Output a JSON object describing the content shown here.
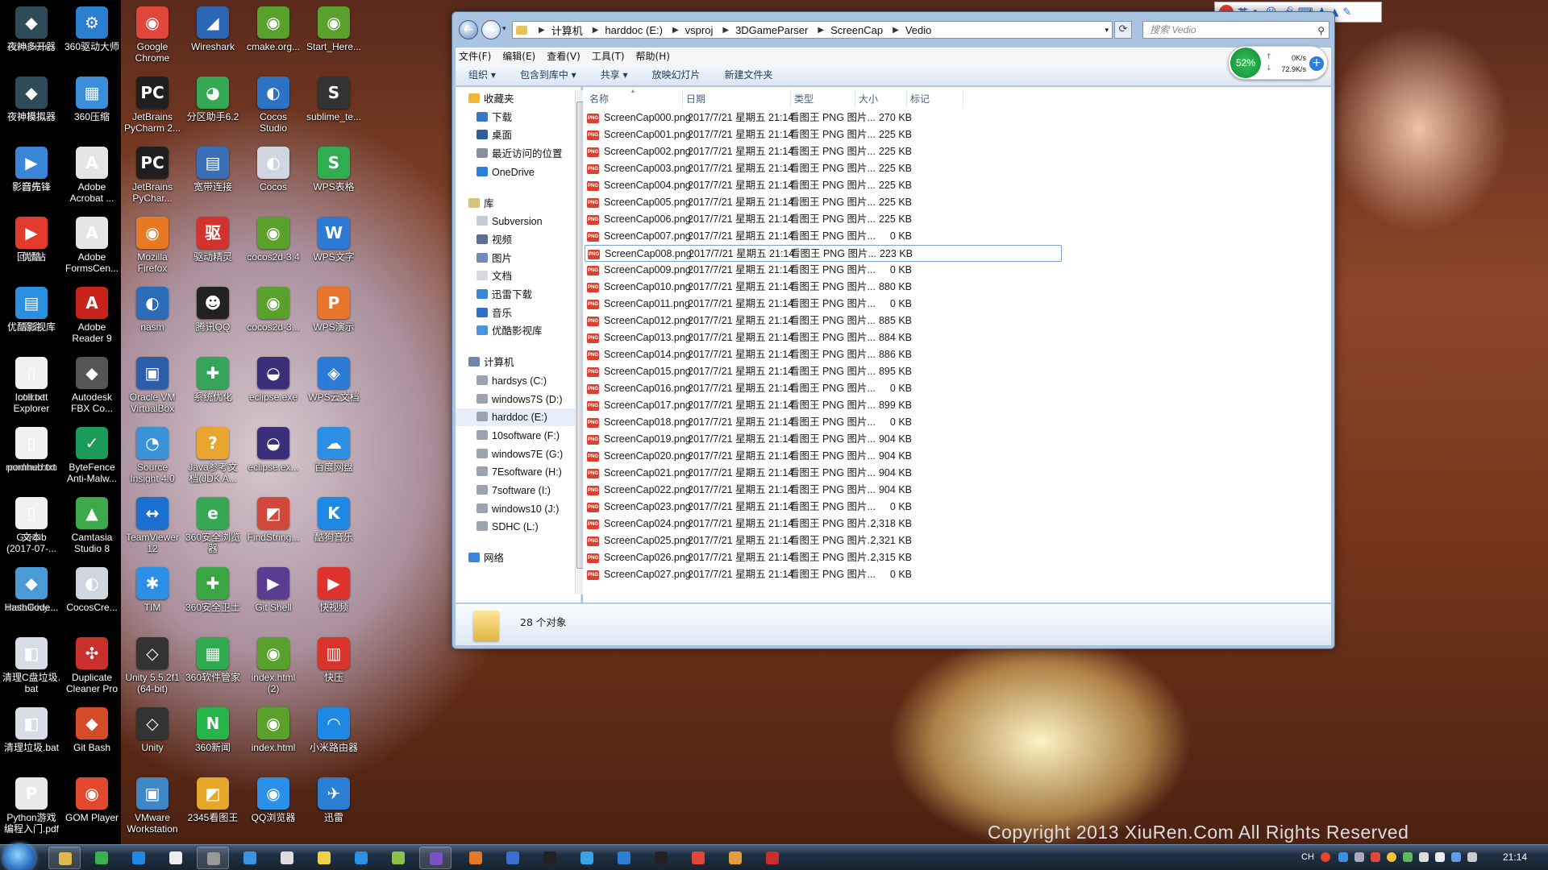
{
  "desktop": {
    "watermark": "Copyright 2013 XiuRen.Com  All Rights Reserved",
    "icons": [
      {
        "label": "Administr...",
        "glyph": "▮",
        "color": "#e0b74a"
      },
      {
        "label": "计算机",
        "glyph": "▭",
        "color": "#3a7bd5"
      },
      {
        "label": "网络",
        "glyph": "◍",
        "color": "#2a8ad4"
      },
      {
        "label": "回收站",
        "glyph": "♻",
        "color": "#9aa6b2"
      },
      {
        "label": "璐璐",
        "glyph": "▮",
        "color": "#e0b74a"
      },
      {
        "label": "Internet\nExplorer",
        "glyph": "e",
        "color": "#1e7bd6"
      },
      {
        "label": "readme.htm",
        "glyph": "◉",
        "color": "#5aa02c"
      },
      {
        "label": "GitHub",
        "glyph": "●",
        "color": "#6a4fb5"
      },
      {
        "label": "installkivy...",
        "glyph": "◧",
        "color": "#d8dde6"
      },
      {
        "label": "清理C盘垃圾.\nbat",
        "glyph": "◧",
        "color": "#d8dde6"
      },
      {
        "label": "清理垃圾.bat",
        "glyph": "◧",
        "color": "#d8dde6"
      },
      {
        "label": "Python游戏\n编程入门.pdf",
        "glyph": "P",
        "color": "#e9e9e9"
      },
      {
        "label": "360驱动大师",
        "glyph": "⚙",
        "color": "#2b7fd0"
      },
      {
        "label": "360压缩",
        "glyph": "▦",
        "color": "#3b8fd9"
      },
      {
        "label": "Adobe\nAcrobat ...",
        "glyph": "A",
        "color": "#e5e5e5"
      },
      {
        "label": "Adobe\nFormsCen...",
        "glyph": "A",
        "color": "#e5e5e5"
      },
      {
        "label": "Adobe\nReader 9",
        "glyph": "A",
        "color": "#c9241b"
      },
      {
        "label": "Autodesk\nFBX Co...",
        "glyph": "◆",
        "color": "#555"
      },
      {
        "label": "ByteFence\nAnti-Malw...",
        "glyph": "✓",
        "color": "#1b9b5a"
      },
      {
        "label": "Camtasia\nStudio 8",
        "glyph": "▲",
        "color": "#3da94b"
      },
      {
        "label": "CocosCre...",
        "glyph": "◐",
        "color": "#cfd6e0"
      },
      {
        "label": "Duplicate\nCleaner Pro",
        "glyph": "✣",
        "color": "#c9302c"
      },
      {
        "label": "Git Bash",
        "glyph": "◆",
        "color": "#d54b2a"
      },
      {
        "label": "GOM Player",
        "glyph": "◉",
        "color": "#e14a2e"
      },
      {
        "label": "Google\nChrome",
        "glyph": "◉",
        "color": "#e0463a"
      },
      {
        "label": "JetBrains\nPyCharm 2...",
        "glyph": "PC",
        "color": "#1f1f1f"
      },
      {
        "label": "JetBrains\nPyChar...",
        "glyph": "PC",
        "color": "#1f1f1f"
      },
      {
        "label": "Mozilla\nFirefox",
        "glyph": "◉",
        "color": "#e77824"
      },
      {
        "label": "nasm",
        "glyph": "◐",
        "color": "#2c6bb8"
      },
      {
        "label": "Oracle VM\nVirtualBox",
        "glyph": "▣",
        "color": "#2c5da8"
      },
      {
        "label": "Source\nInsight 4.0",
        "glyph": "◔",
        "color": "#3a93d8"
      },
      {
        "label": "TeamViewer\n12",
        "glyph": "↔",
        "color": "#1b6fd0"
      },
      {
        "label": "TIM",
        "glyph": "✱",
        "color": "#2a8fe6"
      },
      {
        "label": "Unity 5.5.2f1\n(64-bit)",
        "glyph": "◇",
        "color": "#333"
      },
      {
        "label": "Unity",
        "glyph": "◇",
        "color": "#333"
      },
      {
        "label": "VMware\nWorkstation",
        "glyph": "▣",
        "color": "#3f86c7"
      },
      {
        "label": "Wireshark",
        "glyph": "◢",
        "color": "#2b67b5"
      },
      {
        "label": "分区助手6.2",
        "glyph": "◕",
        "color": "#34a853"
      },
      {
        "label": "宽带连接",
        "glyph": "▤",
        "color": "#3a6fb8"
      },
      {
        "label": "驱动精灵",
        "glyph": "驱",
        "color": "#d4322c"
      },
      {
        "label": "腾讯QQ",
        "glyph": "☻",
        "color": "#222"
      },
      {
        "label": "系统优化",
        "glyph": "✚",
        "color": "#37a45b"
      },
      {
        "label": "Java参考文\n档(JDK A...",
        "glyph": "?",
        "color": "#e8a630"
      },
      {
        "label": "360安全浏览\n器",
        "glyph": "e",
        "color": "#34a853"
      },
      {
        "label": "360安全卫士",
        "glyph": "✚",
        "color": "#3aa642"
      },
      {
        "label": "360软件管家",
        "glyph": "▦",
        "color": "#2faa4e"
      },
      {
        "label": "360新闻",
        "glyph": "N",
        "color": "#27b54a"
      },
      {
        "label": "2345看图王",
        "glyph": "◩",
        "color": "#e4a72a"
      },
      {
        "label": "cmake.org...",
        "glyph": "◉",
        "color": "#5aa02c"
      },
      {
        "label": "Cocos\nStudio",
        "glyph": "◐",
        "color": "#2d73c4"
      },
      {
        "label": "Cocos",
        "glyph": "◐",
        "color": "#cfd6e0"
      },
      {
        "label": "cocos2d-3.4",
        "glyph": "◉",
        "color": "#5aa02c"
      },
      {
        "label": "cocos2d-3...",
        "glyph": "◉",
        "color": "#5aa02c"
      },
      {
        "label": "eclipse.exe",
        "glyph": "◒",
        "color": "#3b2f7a"
      },
      {
        "label": "eclipse.ex...",
        "glyph": "◒",
        "color": "#3b2f7a"
      },
      {
        "label": "FindString...",
        "glyph": "◩",
        "color": "#d0473b"
      },
      {
        "label": "Git Shell",
        "glyph": "▶",
        "color": "#5a3c91"
      },
      {
        "label": "index.html\n(2)",
        "glyph": "◉",
        "color": "#5aa02c"
      },
      {
        "label": "index.html",
        "glyph": "◉",
        "color": "#5aa02c"
      },
      {
        "label": "QQ浏览器",
        "glyph": "◉",
        "color": "#2a8fe6"
      },
      {
        "label": "Start_Here...",
        "glyph": "◉",
        "color": "#5aa02c"
      },
      {
        "label": "sublime_te...",
        "glyph": "S",
        "color": "#333"
      },
      {
        "label": "WPS表格",
        "glyph": "S",
        "color": "#2fae4f"
      },
      {
        "label": "WPS文字",
        "glyph": "W",
        "color": "#2c7ad6"
      },
      {
        "label": "WPS演示",
        "glyph": "P",
        "color": "#e8752b"
      },
      {
        "label": "WPS云文档",
        "glyph": "◈",
        "color": "#2c7ad6"
      },
      {
        "label": "百度网盘",
        "glyph": "☁",
        "color": "#2c8fe6"
      },
      {
        "label": "酷狗音乐",
        "glyph": "K",
        "color": "#1e88e5"
      },
      {
        "label": "快视频",
        "glyph": "▶",
        "color": "#e0322c"
      },
      {
        "label": "快压",
        "glyph": "▥",
        "color": "#d9342b"
      },
      {
        "label": "小米路由器",
        "glyph": "◠",
        "color": "#1e88e5"
      },
      {
        "label": "迅雷",
        "glyph": "✈",
        "color": "#2a7fd4"
      },
      {
        "label": "夜神多开器",
        "glyph": "◆",
        "color": "#2f4b5a"
      },
      {
        "label": "夜神模拟器",
        "glyph": "◆",
        "color": "#2f4b5a"
      },
      {
        "label": "影音先锋",
        "glyph": "▶",
        "color": "#3a85d8"
      },
      {
        "label": "优酷",
        "glyph": "▶",
        "color": "#e33a2e"
      },
      {
        "label": "优酷影视库",
        "glyph": "▤",
        "color": "#2b8fe0"
      },
      {
        "label": "coll.txt",
        "glyph": "▯",
        "color": "#f1f1f1"
      },
      {
        "label": "pornhub.txt",
        "glyph": "▯",
        "color": "#f1f1f1"
      },
      {
        "label": "文本\n(2017-07-...",
        "glyph": "▯",
        "color": "#f1f1f1"
      },
      {
        "label": "HashCode...",
        "glyph": "◆",
        "color": "#4a9ad8"
      }
    ]
  },
  "explorer": {
    "address": [
      "计算机",
      "harddoc (E:)",
      "vsproj",
      "3DGameParser",
      "ScreenCap",
      "Vedio"
    ],
    "search_placeholder": "搜索 Vedio",
    "menus": [
      "文件(F)",
      "编辑(E)",
      "查看(V)",
      "工具(T)",
      "帮助(H)"
    ],
    "commands": [
      "组织 ▾",
      "包含到库中 ▾",
      "共享 ▾",
      "放映幻灯片",
      "新建文件夹"
    ],
    "speed": {
      "percent": "52%",
      "up": "0K/s",
      "down": "72.9K/s"
    },
    "nav": {
      "favorites": "收藏夹",
      "fav_items": [
        "下载",
        "桌面",
        "最近访问的位置",
        "OneDrive"
      ],
      "library": "库",
      "lib_items": [
        "Subversion",
        "视频",
        "图片",
        "文档",
        "迅雷下载",
        "音乐",
        "优酷影视库"
      ],
      "computer": "计算机",
      "drives": [
        "hardsys (C:)",
        "windows7S (D:)",
        "harddoc (E:)",
        "10software (F:)",
        "windows7E (G:)",
        "7Esoftware (H:)",
        "7software (I:)",
        "windows10 (J:)",
        "SDHC (L:)"
      ],
      "network": "网络"
    },
    "columns": [
      "名称",
      "日期",
      "类型",
      "大小",
      "标记"
    ],
    "files": [
      {
        "name": "ScreenCap000.png",
        "date": "2017/7/21 星期五 21:14",
        "type": "看图王 PNG 图片...",
        "size": "270 KB"
      },
      {
        "name": "ScreenCap001.png",
        "date": "2017/7/21 星期五 21:14",
        "type": "看图王 PNG 图片...",
        "size": "225 KB"
      },
      {
        "name": "ScreenCap002.png",
        "date": "2017/7/21 星期五 21:14",
        "type": "看图王 PNG 图片...",
        "size": "225 KB"
      },
      {
        "name": "ScreenCap003.png",
        "date": "2017/7/21 星期五 21:14",
        "type": "看图王 PNG 图片...",
        "size": "225 KB"
      },
      {
        "name": "ScreenCap004.png",
        "date": "2017/7/21 星期五 21:14",
        "type": "看图王 PNG 图片...",
        "size": "225 KB"
      },
      {
        "name": "ScreenCap005.png",
        "date": "2017/7/21 星期五 21:14",
        "type": "看图王 PNG 图片...",
        "size": "225 KB"
      },
      {
        "name": "ScreenCap006.png",
        "date": "2017/7/21 星期五 21:14",
        "type": "看图王 PNG 图片...",
        "size": "225 KB"
      },
      {
        "name": "ScreenCap007.png",
        "date": "2017/7/21 星期五 21:14",
        "type": "看图王 PNG 图片...",
        "size": "0 KB"
      },
      {
        "name": "ScreenCap008.png",
        "date": "2017/7/21 星期五 21:14",
        "type": "看图王 PNG 图片...",
        "size": "223 KB"
      },
      {
        "name": "ScreenCap009.png",
        "date": "2017/7/21 星期五 21:14",
        "type": "看图王 PNG 图片...",
        "size": "0 KB"
      },
      {
        "name": "ScreenCap010.png",
        "date": "2017/7/21 星期五 21:14",
        "type": "看图王 PNG 图片...",
        "size": "880 KB"
      },
      {
        "name": "ScreenCap011.png",
        "date": "2017/7/21 星期五 21:14",
        "type": "看图王 PNG 图片...",
        "size": "0 KB"
      },
      {
        "name": "ScreenCap012.png",
        "date": "2017/7/21 星期五 21:14",
        "type": "看图王 PNG 图片...",
        "size": "885 KB"
      },
      {
        "name": "ScreenCap013.png",
        "date": "2017/7/21 星期五 21:14",
        "type": "看图王 PNG 图片...",
        "size": "884 KB"
      },
      {
        "name": "ScreenCap014.png",
        "date": "2017/7/21 星期五 21:14",
        "type": "看图王 PNG 图片...",
        "size": "886 KB"
      },
      {
        "name": "ScreenCap015.png",
        "date": "2017/7/21 星期五 21:14",
        "type": "看图王 PNG 图片...",
        "size": "895 KB"
      },
      {
        "name": "ScreenCap016.png",
        "date": "2017/7/21 星期五 21:14",
        "type": "看图王 PNG 图片...",
        "size": "0 KB"
      },
      {
        "name": "ScreenCap017.png",
        "date": "2017/7/21 星期五 21:14",
        "type": "看图王 PNG 图片...",
        "size": "899 KB"
      },
      {
        "name": "ScreenCap018.png",
        "date": "2017/7/21 星期五 21:14",
        "type": "看图王 PNG 图片...",
        "size": "0 KB"
      },
      {
        "name": "ScreenCap019.png",
        "date": "2017/7/21 星期五 21:14",
        "type": "看图王 PNG 图片...",
        "size": "904 KB"
      },
      {
        "name": "ScreenCap020.png",
        "date": "2017/7/21 星期五 21:14",
        "type": "看图王 PNG 图片...",
        "size": "904 KB"
      },
      {
        "name": "ScreenCap021.png",
        "date": "2017/7/21 星期五 21:14",
        "type": "看图王 PNG 图片...",
        "size": "904 KB"
      },
      {
        "name": "ScreenCap022.png",
        "date": "2017/7/21 星期五 21:14",
        "type": "看图王 PNG 图片...",
        "size": "904 KB"
      },
      {
        "name": "ScreenCap023.png",
        "date": "2017/7/21 星期五 21:14",
        "type": "看图王 PNG 图片...",
        "size": "0 KB"
      },
      {
        "name": "ScreenCap024.png",
        "date": "2017/7/21 星期五 21:14",
        "type": "看图王 PNG 图片...",
        "size": "2,318 KB"
      },
      {
        "name": "ScreenCap025.png",
        "date": "2017/7/21 星期五 21:14",
        "type": "看图王 PNG 图片...",
        "size": "2,321 KB"
      },
      {
        "name": "ScreenCap026.png",
        "date": "2017/7/21 星期五 21:14",
        "type": "看图王 PNG 图片...",
        "size": "2,315 KB"
      },
      {
        "name": "ScreenCap027.png",
        "date": "2017/7/21 星期五 21:14",
        "type": "看图王 PNG 图片...",
        "size": "0 KB"
      }
    ],
    "focused_index": 8,
    "status_count": "28 个对象"
  },
  "ime": {
    "mode": "英"
  },
  "taskbar": {
    "clock": "21:14",
    "lang": "CH",
    "apps": [
      {
        "name": "explorer",
        "color": "#e3b84b",
        "active": true
      },
      {
        "name": "360",
        "color": "#38b24a",
        "active": false
      },
      {
        "name": "kugou",
        "color": "#1e88e5",
        "active": false
      },
      {
        "name": "shield",
        "color": "#eee",
        "active": false
      },
      {
        "name": "unity",
        "color": "#999",
        "active": true
      },
      {
        "name": "remote",
        "color": "#3a95e0",
        "active": false
      },
      {
        "name": "notepad",
        "color": "#ddd",
        "active": false
      },
      {
        "name": "chat",
        "color": "#f0d24a",
        "active": false
      },
      {
        "name": "browser",
        "color": "#2a8fe6",
        "active": false
      },
      {
        "name": "android",
        "color": "#8bc34a",
        "active": false
      },
      {
        "name": "vs",
        "color": "#7b4fc8",
        "active": true
      },
      {
        "name": "firefox",
        "color": "#e77824",
        "active": false
      },
      {
        "name": "infinity",
        "color": "#3a6fd0",
        "active": false
      },
      {
        "name": "qq",
        "color": "#222",
        "active": false
      },
      {
        "name": "monitor",
        "color": "#3aa2e6",
        "active": false
      },
      {
        "name": "tv",
        "color": "#2a7fd4",
        "active": false
      },
      {
        "name": "pycharm",
        "color": "#222",
        "active": false
      },
      {
        "name": "chrome",
        "color": "#e0463a",
        "active": false
      },
      {
        "name": "paint",
        "color": "#e59b3c",
        "active": false
      },
      {
        "name": "duplicate",
        "color": "#c9302c",
        "active": false
      }
    ]
  }
}
